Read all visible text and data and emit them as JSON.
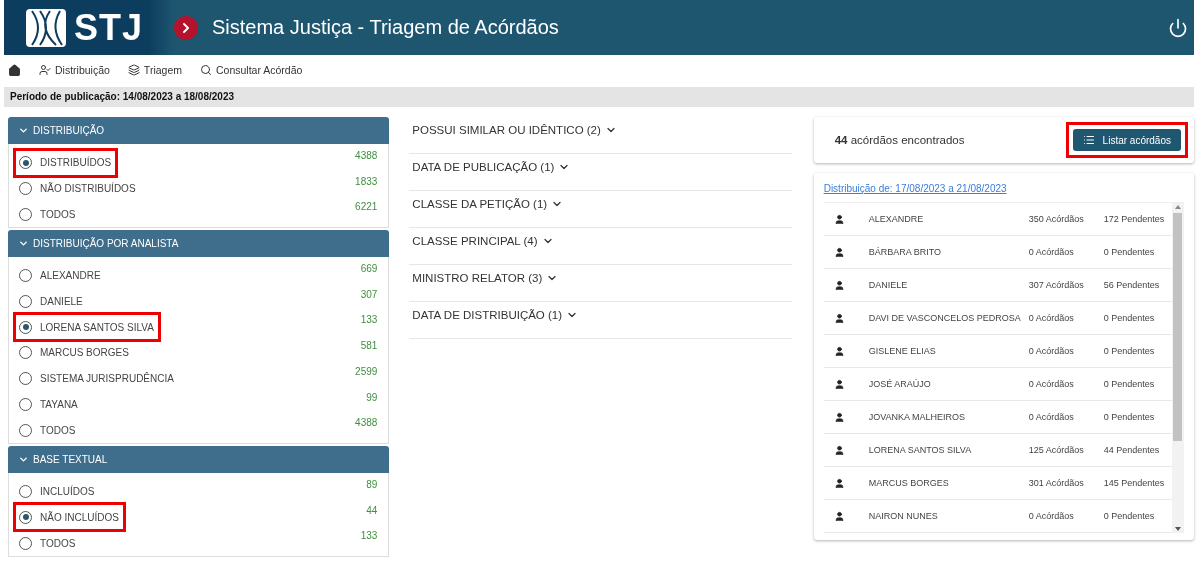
{
  "header": {
    "logo_text": "STJ",
    "title": "Sistema Justiça - Triagem de Acórdãos"
  },
  "nav": [
    {
      "label": "Distribuição"
    },
    {
      "label": "Triagem"
    },
    {
      "label": "Consultar Acórdão"
    }
  ],
  "period": "Período de publicação: 14/08/2023 a 18/08/2023",
  "filter_groups": [
    {
      "title": "DISTRIBUIÇÃO",
      "expanded": true,
      "options": [
        {
          "label": "DISTRIBUÍDOS",
          "count": "4388",
          "selected": true,
          "highlighted": true
        },
        {
          "label": "NÃO DISTRIBUÍDOS",
          "count": "1833",
          "selected": false,
          "highlighted": false
        },
        {
          "label": "TODOS",
          "count": "6221",
          "selected": false,
          "highlighted": false
        }
      ]
    },
    {
      "title": "DISTRIBUIÇÃO POR ANALISTA",
      "expanded": true,
      "options": [
        {
          "label": "ALEXANDRE",
          "count": "669",
          "selected": false,
          "highlighted": false
        },
        {
          "label": "DANIELE",
          "count": "307",
          "selected": false,
          "highlighted": false
        },
        {
          "label": "LORENA SANTOS SILVA",
          "count": "133",
          "selected": true,
          "highlighted": true
        },
        {
          "label": "MARCUS BORGES",
          "count": "581",
          "selected": false,
          "highlighted": false
        },
        {
          "label": "SISTEMA JURISPRUDÊNCIA",
          "count": "2599",
          "selected": false,
          "highlighted": false
        },
        {
          "label": "TAYANA",
          "count": "99",
          "selected": false,
          "highlighted": false
        },
        {
          "label": "TODOS",
          "count": "4388",
          "selected": false,
          "highlighted": false
        }
      ]
    },
    {
      "title": "BASE TEXTUAL",
      "expanded": true,
      "options": [
        {
          "label": "INCLUÍDOS",
          "count": "89",
          "selected": false,
          "highlighted": false
        },
        {
          "label": "NÃO INCLUÍDOS",
          "count": "44",
          "selected": true,
          "highlighted": true
        },
        {
          "label": "TODOS",
          "count": "133",
          "selected": false,
          "highlighted": false
        }
      ]
    }
  ],
  "facets": [
    {
      "label": "POSSUI SIMILAR OU IDÊNTICO (2)",
      "expanded": false
    },
    {
      "label": "DATA DE PUBLICAÇÃO (1)",
      "expanded": false
    },
    {
      "label": "CLASSE DA PETIÇÃO (1)",
      "expanded": false
    },
    {
      "label": "CLASSE PRINCIPAL (4)",
      "expanded": false
    },
    {
      "label": "MINISTRO RELATOR (3)",
      "expanded": false
    },
    {
      "label": "DATA DE DISTRIBUIÇÃO (1)",
      "expanded": false
    }
  ],
  "summary": {
    "count": "44",
    "text": "acórdãos encontrados",
    "button": {
      "label": "Listar acórdãos",
      "highlighted": true
    }
  },
  "distribution": {
    "link": "Distribuição de: 17/08/2023 a 21/08/2023",
    "rows": [
      {
        "name": "ALEXANDRE",
        "acordaos": "350 Acórdãos",
        "pendentes": "172 Pendentes"
      },
      {
        "name": "BÁRBARA BRITO",
        "acordaos": "0 Acórdãos",
        "pendentes": "0 Pendentes"
      },
      {
        "name": "DANIELE",
        "acordaos": "307 Acórdãos",
        "pendentes": "56 Pendentes"
      },
      {
        "name": "DAVI DE VASCONCELOS PEDROSA",
        "acordaos": "0 Acórdãos",
        "pendentes": "0 Pendentes"
      },
      {
        "name": "GISLENE ELIAS",
        "acordaos": "0 Acórdãos",
        "pendentes": "0 Pendentes"
      },
      {
        "name": "JOSÉ ARAÚJO",
        "acordaos": "0 Acórdãos",
        "pendentes": "0 Pendentes"
      },
      {
        "name": "JOVANKA MALHEIROS",
        "acordaos": "0 Acórdãos",
        "pendentes": "0 Pendentes"
      },
      {
        "name": "LORENA SANTOS SILVA",
        "acordaos": "125 Acórdãos",
        "pendentes": "44 Pendentes"
      },
      {
        "name": "MARCUS BORGES",
        "acordaos": "301 Acórdãos",
        "pendentes": "145 Pendentes"
      },
      {
        "name": "NAIRON NUNES",
        "acordaos": "0 Acórdãos",
        "pendentes": "0 Pendentes"
      }
    ]
  }
}
